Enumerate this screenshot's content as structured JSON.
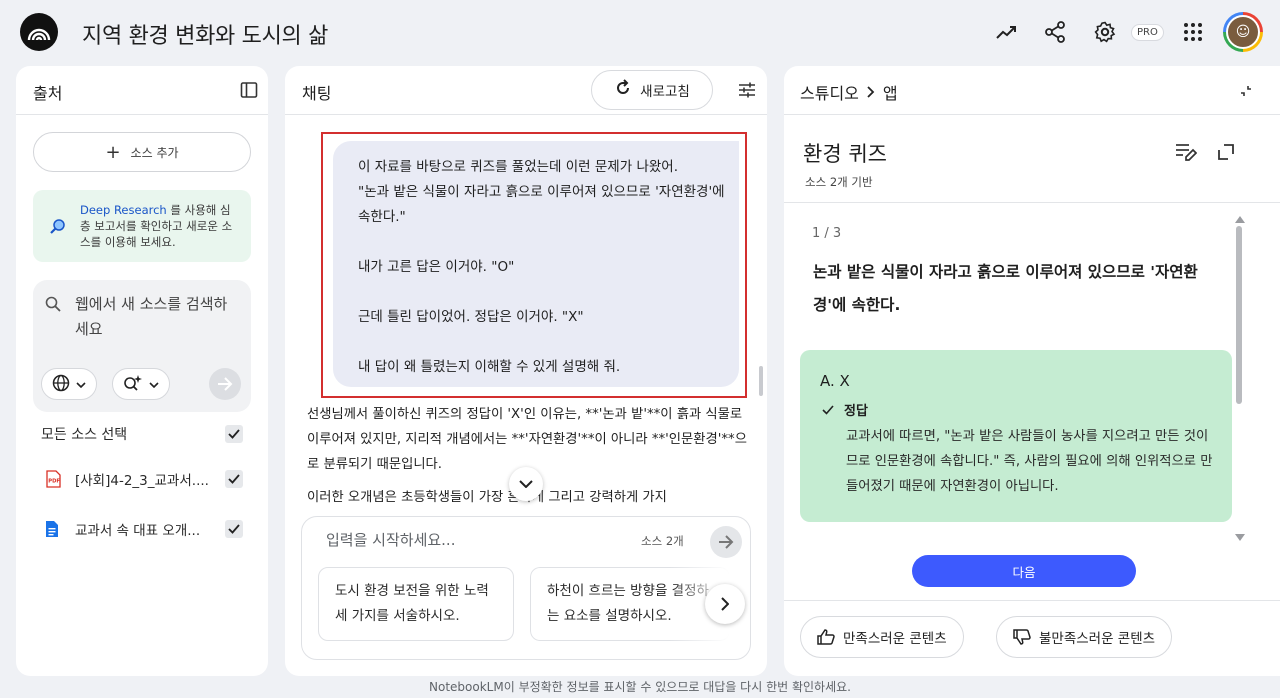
{
  "header": {
    "title": "지역 환경 변화와 도시의 삶",
    "pro_label": "PRO"
  },
  "sources": {
    "title": "출처",
    "add_label": "소스 추가",
    "deep_research_link": "Deep Research",
    "deep_research_text": " 를 사용해 심층 보고서를 확인하고 새로운 소스를 이용해 보세요.",
    "search_placeholder": "웹에서 새 소스를 검색하세요",
    "select_all": "모든 소스 선택",
    "items": [
      {
        "label": "[사회]4-2_3_교과서....",
        "type": "pdf"
      },
      {
        "label": "교과서 속 대표 오개...",
        "type": "doc"
      }
    ]
  },
  "chat": {
    "title": "채팅",
    "refresh_label": "새로고침",
    "user_message": "이 자료를 바탕으로 퀴즈를 풀었는데 이런 문제가 나왔어.\n\"논과 밭은 식물이 자라고 흙으로 이루어져 있으므로 '자연환경'에 속한다.\"\n\n내가 고른 답은 이거야. \"O\"\n\n근데 틀린 답이었어. 정답은 이거야. \"X\"\n\n내 답이 왜 틀렸는지 이해할 수 있게 설명해 줘.",
    "answer_p1": "선생님께서 풀이하신 퀴즈의 정답이 'X'인 이유는, **'논과 밭'**이 흙과 식물로 이루어져 있지만, 지리적 개념에서는 **'자연환경'**이 아니라 **'인문환경'**으로 분류되기 때문입니다.",
    "answer_p2": "이러한 오개념은 초등학생들이 가장 흔하게 그리고 강력하게 가지",
    "input_placeholder": "입력을 시작하세요...",
    "source_count": "소스 2개",
    "suggestions": [
      "도시 환경 보전을 위한 노력 세 가지를 서술하시오.",
      "하천이 흐르는 방향을 결정하는 요소를 설명하시오."
    ]
  },
  "studio": {
    "crumb_root": "스튜디오",
    "crumb_leaf": "앱",
    "quiz_title": "환경 퀴즈",
    "quiz_sub": "소스 2개 기반",
    "question_index": "1 / 3",
    "question": "논과 밭은 식물이 자라고 흙으로 이루어져 있으므로 '자연환경'에 속한다.",
    "answer_option": "A.  X",
    "correct_label": "정답",
    "explanation": "교과서에 따르면, \"논과 밭은 사람들이 농사를 지으려고 만든 것이므로 인문환경에 속합니다.\" 즉, 사람의 필요에 의해 인위적으로 만들어졌기 때문에 자연환경이 아닙니다.",
    "next_label": "다음",
    "good_label": "만족스러운 콘텐츠",
    "bad_label": "불만족스러운 콘텐츠"
  },
  "footer": "NotebookLM이 부정확한 정보를 표시할 수 있으므로 대답을 다시 한번 확인하세요.",
  "colors": {
    "accent": "#3d5afe",
    "highlight": "#d32f2f",
    "answer_bg": "#c5ecd2",
    "deep_research_bg": "#e9f6ee"
  }
}
